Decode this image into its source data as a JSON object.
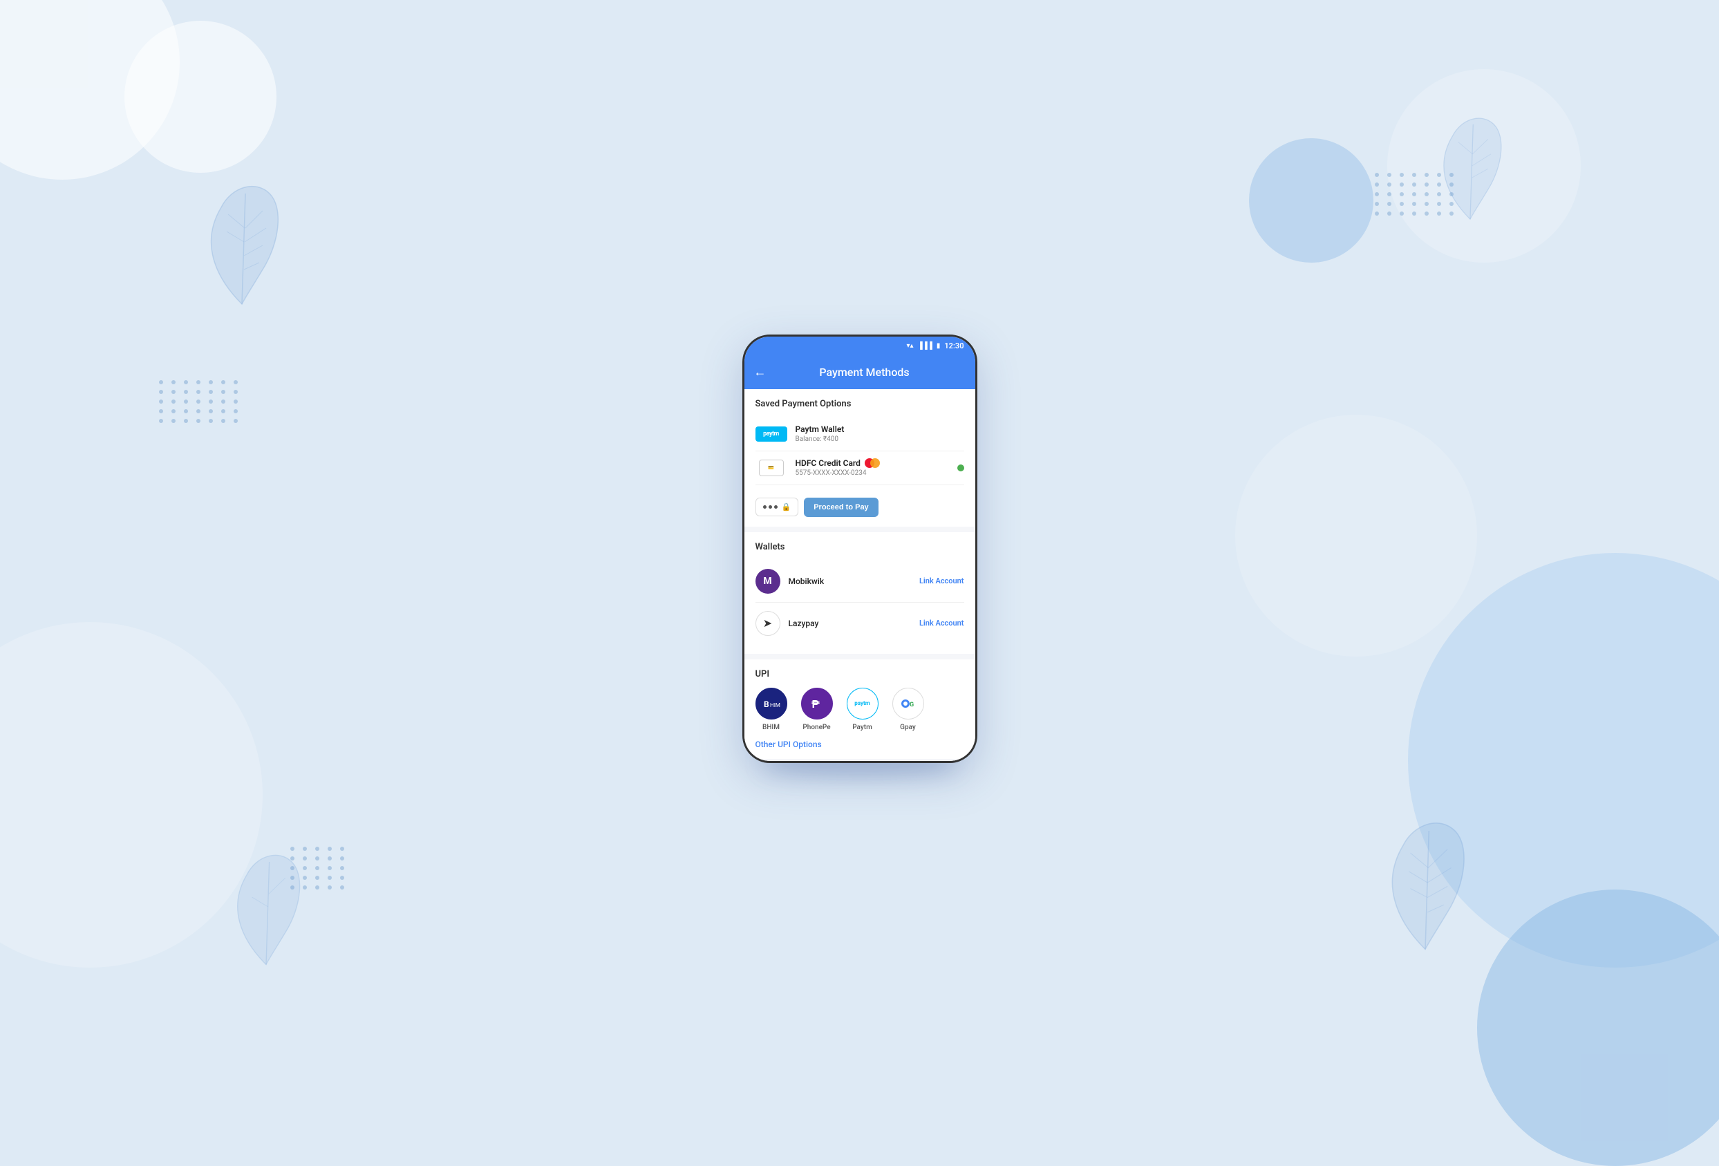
{
  "background": {
    "color": "#deeaf5"
  },
  "status_bar": {
    "time": "12:30",
    "icons": [
      "wifi",
      "signal",
      "battery"
    ]
  },
  "app_bar": {
    "title": "Payment Methods",
    "back_label": "←"
  },
  "saved_section": {
    "title": "Saved Payment Options",
    "items": [
      {
        "name": "Paytm Wallet",
        "detail": "Balance: ₹400",
        "type": "paytm"
      },
      {
        "name": "HDFC Credit Card",
        "detail": "5575-XXXX-XXXX-0234",
        "type": "card",
        "active": true
      }
    ],
    "cvv_placeholder": "···",
    "proceed_label": "Proceed to Pay"
  },
  "wallets_section": {
    "title": "Wallets",
    "items": [
      {
        "name": "Mobikwik",
        "action": "Link Account"
      },
      {
        "name": "Lazypay",
        "action": "Link Account"
      }
    ]
  },
  "upi_section": {
    "title": "UPI",
    "items": [
      {
        "name": "BHIM",
        "color": "#1a237e"
      },
      {
        "name": "PhonePe",
        "color": "#5f259f"
      },
      {
        "name": "Paytm",
        "color": "#00b9f5"
      },
      {
        "name": "Gpay",
        "color": "#fff"
      }
    ],
    "other_label": "Other UPI Options"
  }
}
